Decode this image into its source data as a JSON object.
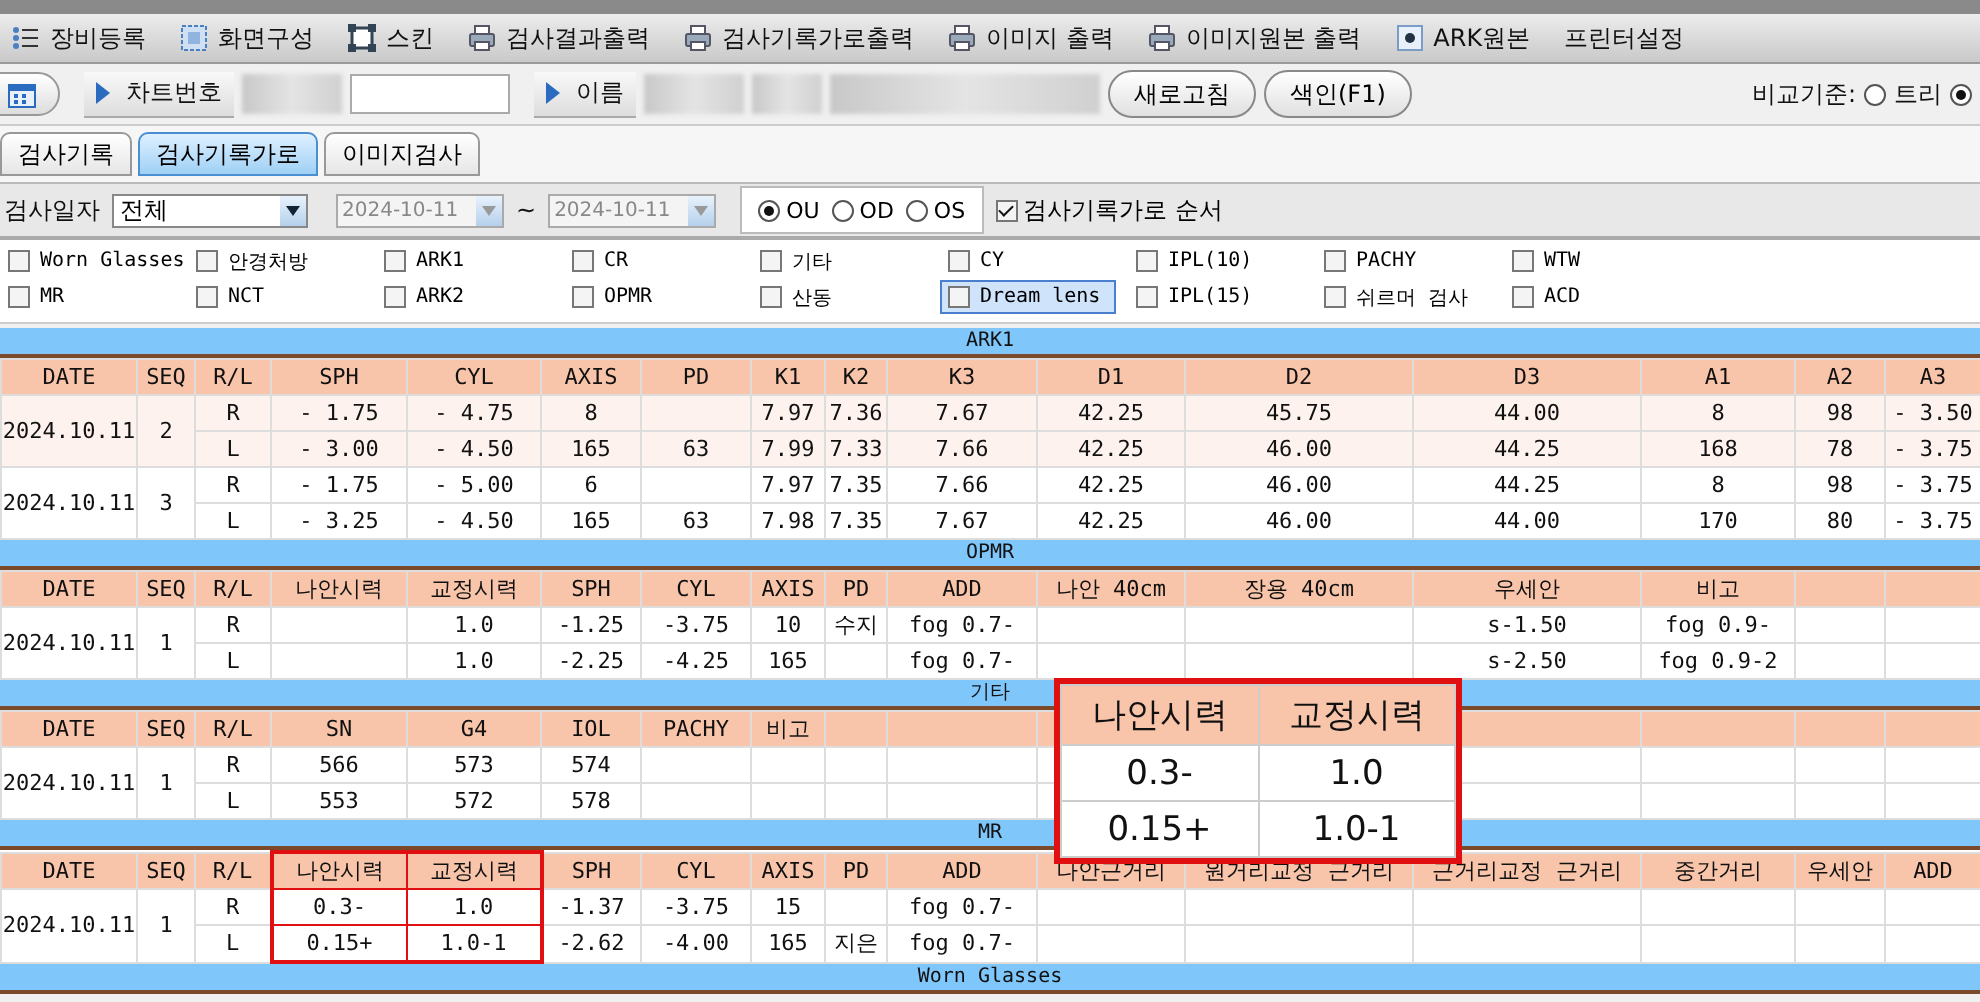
{
  "toolbar": [
    {
      "label": "장비등록",
      "kind": "list"
    },
    {
      "label": "화면구성",
      "kind": "layout"
    },
    {
      "label": "스킨",
      "kind": "skin"
    },
    {
      "label": "검사결과출력",
      "kind": "print"
    },
    {
      "label": "검사기록가로출력",
      "kind": "print"
    },
    {
      "label": "이미지 출력",
      "kind": "print"
    },
    {
      "label": "이미지원본 출력",
      "kind": "print"
    },
    {
      "label": "ARK원본",
      "kind": "toggle",
      "on": true
    },
    {
      "label": "프린터설정",
      "kind": "plain"
    }
  ],
  "patient_bar": {
    "chart_label": "차트번호",
    "name_label": "이름",
    "buttons": [
      "새로고침",
      "색인(F1)"
    ],
    "compare": {
      "label": "비교기준:",
      "options": [
        {
          "label": "트리",
          "selected": false
        },
        {
          "selected": true
        }
      ]
    }
  },
  "tabs": [
    {
      "label": "검사기록",
      "selected": false
    },
    {
      "label": "검사기록가로",
      "selected": true
    },
    {
      "label": "이미지검사",
      "selected": false
    }
  ],
  "filter": {
    "label": "검사일자",
    "select": "전체",
    "date_from": {
      "value": "2024-10-11",
      "disabled": true
    },
    "separator": "~",
    "date_to": {
      "value": "2024-10-11",
      "disabled": true
    },
    "eye_options": [
      {
        "label": "OU",
        "selected": true
      },
      {
        "label": "OD",
        "selected": false
      },
      {
        "label": "OS",
        "selected": false
      }
    ],
    "order_checkbox": {
      "label": "검사기록가로 순서",
      "checked": true
    }
  },
  "tests": [
    {
      "label": "Worn Glasses",
      "checked": false,
      "focused": false
    },
    {
      "label": "안경처방",
      "checked": false,
      "focused": false
    },
    {
      "label": "ARK1",
      "checked": false,
      "focused": false
    },
    {
      "label": "CR",
      "checked": false,
      "focused": false
    },
    {
      "label": "기타",
      "checked": false,
      "focused": false
    },
    {
      "label": "CY",
      "checked": false,
      "focused": false
    },
    {
      "label": "IPL(10)",
      "checked": false,
      "focused": false
    },
    {
      "label": "PACHY",
      "checked": false,
      "focused": false
    },
    {
      "label": "WTW",
      "checked": false,
      "focused": false
    },
    {
      "label": "MR",
      "checked": false,
      "focused": false
    },
    {
      "label": "NCT",
      "checked": false,
      "focused": false
    },
    {
      "label": "ARK2",
      "checked": false,
      "focused": false
    },
    {
      "label": "OPMR",
      "checked": false,
      "focused": false
    },
    {
      "label": "산동",
      "checked": false,
      "focused": false
    },
    {
      "label": "Dream lens",
      "checked": false,
      "focused": true
    },
    {
      "label": "IPL(15)",
      "checked": false,
      "focused": false
    },
    {
      "label": "쉬르머 검사",
      "checked": false,
      "focused": false
    },
    {
      "label": "ACD",
      "checked": false,
      "focused": false
    }
  ],
  "sections": [
    {
      "title": "ARK1",
      "columns": [
        {
          "label": "DATE",
          "highlighted": false
        },
        {
          "label": "SEQ",
          "highlighted": false
        },
        {
          "label": "R/L",
          "highlighted": false
        },
        {
          "label": "SPH",
          "highlighted": false
        },
        {
          "label": "CYL",
          "highlighted": false
        },
        {
          "label": "AXIS",
          "highlighted": false
        },
        {
          "label": "PD",
          "highlighted": false
        },
        {
          "label": "K1",
          "highlighted": false
        },
        {
          "label": "K2",
          "highlighted": false
        },
        {
          "label": "K3",
          "highlighted": false
        },
        {
          "label": "D1",
          "highlighted": false
        },
        {
          "label": "D2",
          "highlighted": false
        },
        {
          "label": "D3",
          "highlighted": false
        },
        {
          "label": "A1",
          "highlighted": false
        },
        {
          "label": "A2",
          "highlighted": false
        },
        {
          "label": "A3",
          "highlighted": false
        }
      ],
      "groups": [
        {
          "date": "2024.10.11",
          "seq": "2",
          "rows": [
            {
              "side": "R",
              "cells": [
                "- 1.75",
                "- 4.75",
                "8",
                null,
                "7.97",
                "7.36",
                "7.67",
                "42.25",
                "45.75",
                "44.00",
                "8",
                "98",
                "- 3.50"
              ]
            },
            {
              "side": "L",
              "cells": [
                "- 3.00",
                "- 4.50",
                "165",
                "63",
                "7.99",
                "7.33",
                "7.66",
                "42.25",
                "46.00",
                "44.25",
                "168",
                "78",
                "- 3.75"
              ]
            }
          ]
        },
        {
          "date": "2024.10.11",
          "seq": "3",
          "rows": [
            {
              "side": "R",
              "cells": [
                "- 1.75",
                "- 5.00",
                "6",
                null,
                "7.97",
                "7.35",
                "7.66",
                "42.25",
                "46.00",
                "44.25",
                "8",
                "98",
                "- 3.75"
              ]
            },
            {
              "side": "L",
              "cells": [
                "- 3.25",
                "- 4.50",
                "165",
                "63",
                "7.98",
                "7.35",
                "7.67",
                "42.25",
                "46.00",
                "44.00",
                "170",
                "80",
                "- 3.75"
              ]
            }
          ]
        }
      ]
    },
    {
      "title": "OPMR",
      "columns": [
        {
          "label": "DATE",
          "highlighted": false
        },
        {
          "label": "SEQ",
          "highlighted": false
        },
        {
          "label": "R/L",
          "highlighted": false
        },
        {
          "label": "나안시력",
          "highlighted": false
        },
        {
          "label": "교정시력",
          "highlighted": false
        },
        {
          "label": "SPH",
          "highlighted": false
        },
        {
          "label": "CYL",
          "highlighted": false
        },
        {
          "label": "AXIS",
          "highlighted": false
        },
        {
          "label": "PD",
          "highlighted": false
        },
        {
          "label": "ADD",
          "highlighted": false
        },
        {
          "label": "나안 40cm",
          "highlighted": false
        },
        {
          "label": "장용 40cm",
          "highlighted": false
        },
        {
          "label": "우세안",
          "highlighted": false
        },
        {
          "label": "비고",
          "highlighted": false
        }
      ],
      "groups": [
        {
          "date": "2024.10.11",
          "seq": "1",
          "rows": [
            {
              "side": "R",
              "cells": [
                null,
                "1.0",
                "-1.25",
                "-3.75",
                "10",
                "수지",
                "fog 0.7-",
                null,
                null,
                "s-1.50",
                "fog 0.9-"
              ]
            },
            {
              "side": "L",
              "cells": [
                null,
                "1.0",
                "-2.25",
                "-4.25",
                "165",
                null,
                "fog 0.7-",
                null,
                null,
                "s-2.50",
                "fog 0.9-2"
              ]
            }
          ]
        }
      ]
    },
    {
      "title": "기타",
      "columns": [
        {
          "label": "DATE",
          "highlighted": false
        },
        {
          "label": "SEQ",
          "highlighted": false
        },
        {
          "label": "R/L",
          "highlighted": false
        },
        {
          "label": "SN",
          "highlighted": false
        },
        {
          "label": "G4",
          "highlighted": false
        },
        {
          "label": "IOL",
          "highlighted": false
        },
        {
          "label": "PACHY",
          "highlighted": false
        },
        {
          "label": "비고",
          "highlighted": false
        }
      ],
      "groups": [
        {
          "date": "2024.10.11",
          "seq": "1",
          "rows": [
            {
              "side": "R",
              "cells": [
                "566",
                "573",
                "574"
              ]
            },
            {
              "side": "L",
              "cells": [
                "553",
                "572",
                "578"
              ]
            }
          ]
        }
      ]
    },
    {
      "title": "MR",
      "columns": [
        {
          "label": "DATE",
          "highlighted": false
        },
        {
          "label": "SEQ",
          "highlighted": false
        },
        {
          "label": "R/L",
          "highlighted": false
        },
        {
          "label": "나안시력",
          "highlighted": true
        },
        {
          "label": "교정시력",
          "highlighted": true
        },
        {
          "label": "SPH",
          "highlighted": false
        },
        {
          "label": "CYL",
          "highlighted": false
        },
        {
          "label": "AXIS",
          "highlighted": false
        },
        {
          "label": "PD",
          "highlighted": false
        },
        {
          "label": "ADD",
          "highlighted": false
        },
        {
          "label": "나안근거리",
          "highlighted": false
        },
        {
          "label": "원거리교정 근거리",
          "highlighted": false
        },
        {
          "label": "근거리교정 근거리",
          "highlighted": false
        },
        {
          "label": "중간거리",
          "highlighted": false
        },
        {
          "label": "우세안",
          "highlighted": false
        },
        {
          "label": "ADD",
          "highlighted": false
        }
      ],
      "groups": [
        {
          "date": "2024.10.11",
          "seq": "1",
          "rows": [
            {
              "side": "R",
              "cells": [
                "0.3-",
                "1.0",
                "-1.37",
                "-3.75",
                "15",
                null,
                "fog 0.7-"
              ]
            },
            {
              "side": "L",
              "cells": [
                "0.15+",
                "1.0-1",
                "-2.62",
                "-4.00",
                "165",
                "지은",
                "fog 0.7-"
              ]
            }
          ]
        }
      ]
    },
    {
      "title": "Worn Glasses"
    }
  ],
  "callout": {
    "columns": [
      "나안시력",
      "교정시력"
    ],
    "rows": [
      [
        "0.3-",
        "1.0"
      ],
      [
        "0.15+",
        "1.0-1"
      ]
    ]
  }
}
